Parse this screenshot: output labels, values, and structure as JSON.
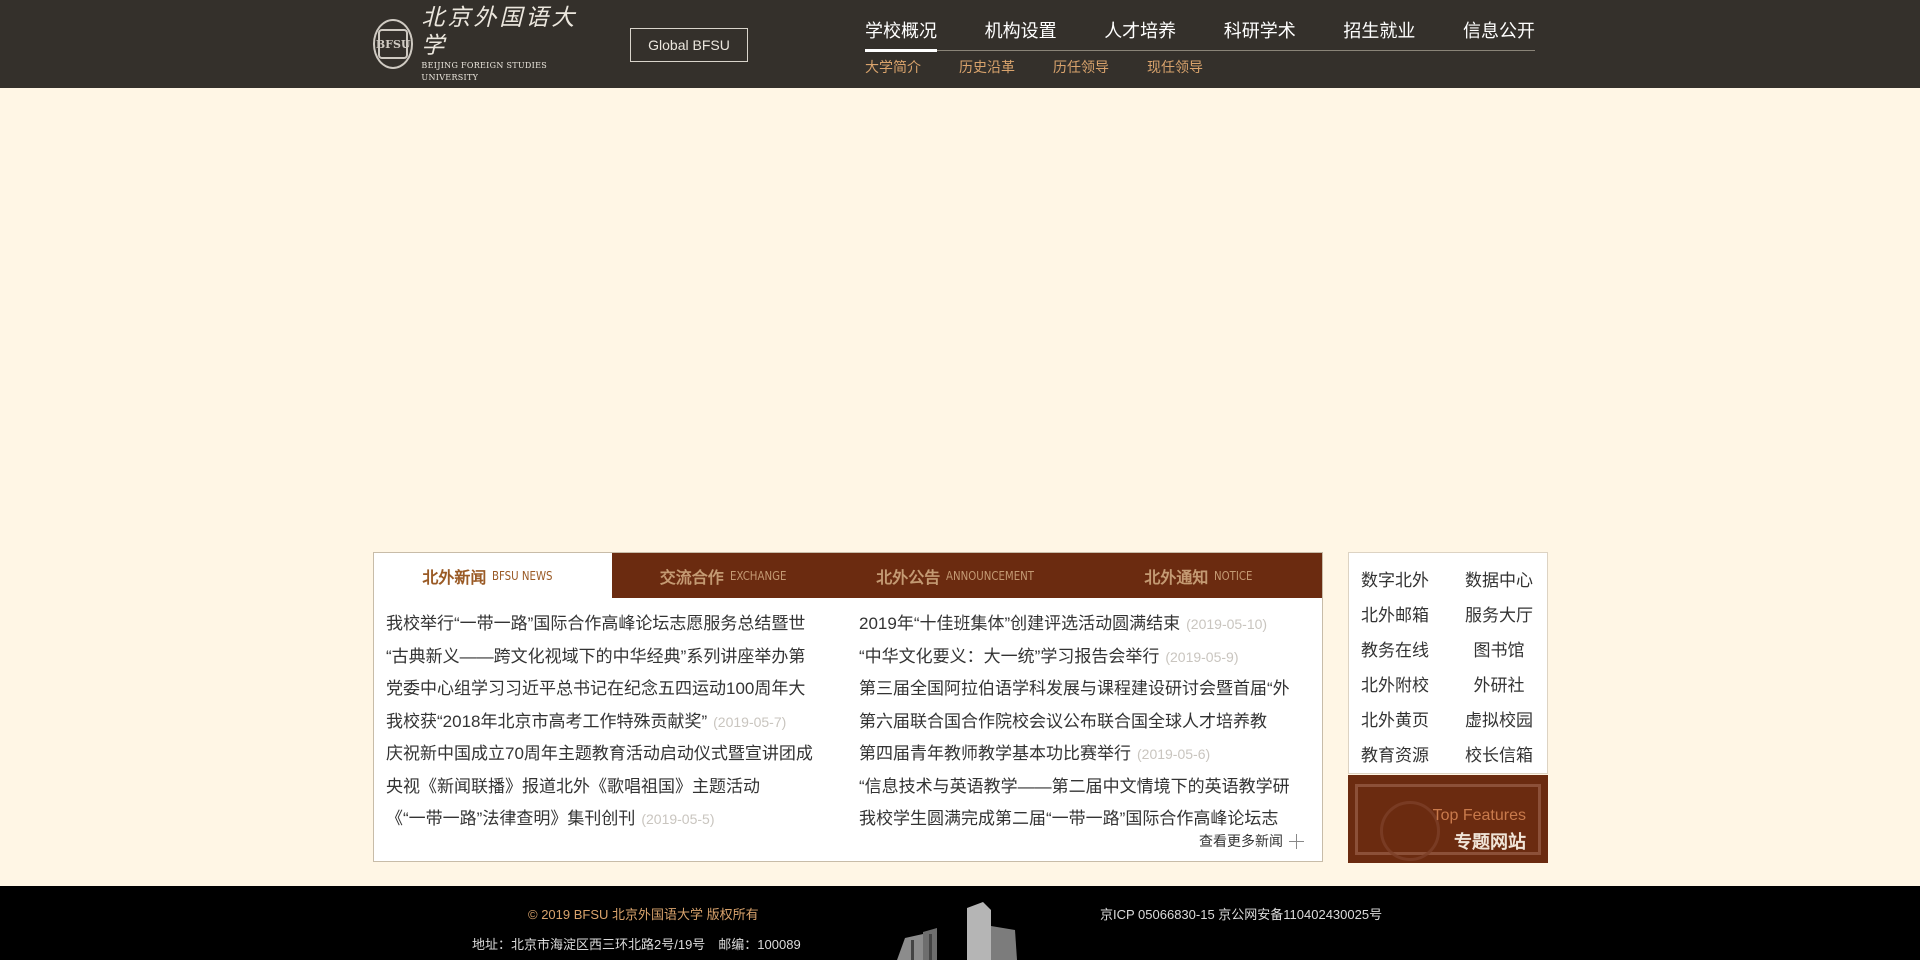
{
  "header": {
    "logo_cn": "北京外国语大学",
    "logo_en": "BEIJING FOREIGN STUDIES UNIVERSITY",
    "seal_text": "BFSU",
    "global_button": "Global BFSU",
    "main_nav": [
      "学校概况",
      "机构设置",
      "人才培养",
      "科研学术",
      "招生就业",
      "信息公开"
    ],
    "sub_nav": [
      "大学简介",
      "历史沿革",
      "历任领导",
      "现任领导"
    ]
  },
  "news_tabs": [
    {
      "cn": "北外新闻",
      "en": "BFSU NEWS"
    },
    {
      "cn": "交流合作",
      "en": "EXCHANGE"
    },
    {
      "cn": "北外公告",
      "en": "ANNOUNCEMENT"
    },
    {
      "cn": "北外通知",
      "en": "NOTICE"
    }
  ],
  "news_left": [
    {
      "title": "我校举行“一带一路”国际合作高峰论坛志愿服务总结暨世",
      "date": ""
    },
    {
      "title": "“古典新义——跨文化视域下的中华经典”系列讲座举办第",
      "date": ""
    },
    {
      "title": "党委中心组学习习近平总书记在纪念五四运动100周年大",
      "date": ""
    },
    {
      "title": "我校获“2018年北京市高考工作特殊贡献奖”",
      "date": "(2019-05-7)"
    },
    {
      "title": "庆祝新中国成立70周年主题教育活动启动仪式暨宣讲团成",
      "date": ""
    },
    {
      "title": "央视《新闻联播》报道北外《歌唱祖国》主题活动",
      "date": ""
    },
    {
      "title": "《“一带一路”法律查明》集刊创刊",
      "date": "(2019-05-5)"
    }
  ],
  "news_right": [
    {
      "title": "2019年“十佳班集体”创建评选活动圆满结束",
      "date": "(2019-05-10)"
    },
    {
      "title": "“中华文化要义：大一统”学习报告会举行",
      "date": "(2019-05-9)"
    },
    {
      "title": "第三届全国阿拉伯语学科发展与课程建设研讨会暨首届“外",
      "date": ""
    },
    {
      "title": "第六届联合国合作院校会议公布联合国全球人才培养教",
      "date": ""
    },
    {
      "title": "第四届青年教师教学基本功比赛举行",
      "date": "(2019-05-6)"
    },
    {
      "title": "“信息技术与英语教学——第二届中文情境下的英语教学研",
      "date": ""
    },
    {
      "title": "我校学生圆满完成第二届“一带一路”国际合作高峰论坛志",
      "date": ""
    }
  ],
  "more_news": "查看更多新闻",
  "quick_links": [
    "数字北外",
    "数据中心",
    "北外邮箱",
    "服务大厅",
    "教务在线",
    "图书馆",
    "北外附校",
    "外研社",
    "北外黄页",
    "虚拟校园",
    "教育资源",
    "校长信箱"
  ],
  "feature": {
    "en": "Top Features",
    "cn": "专题网站"
  },
  "footer": {
    "copyright": "© 2019 BFSU 北京外国语大学 版权所有",
    "address": "地址：北京市海淀区西三环北路2号/19号　邮编：100089",
    "icp": "京ICP 05066830-15 京公网安备110402430025号"
  },
  "colors": {
    "header_bg": "#34302b",
    "page_bg": "#fff6e5",
    "accent_brown": "#6b2b10",
    "accent_gold": "#d9a36c",
    "footer_bg": "#000000"
  }
}
